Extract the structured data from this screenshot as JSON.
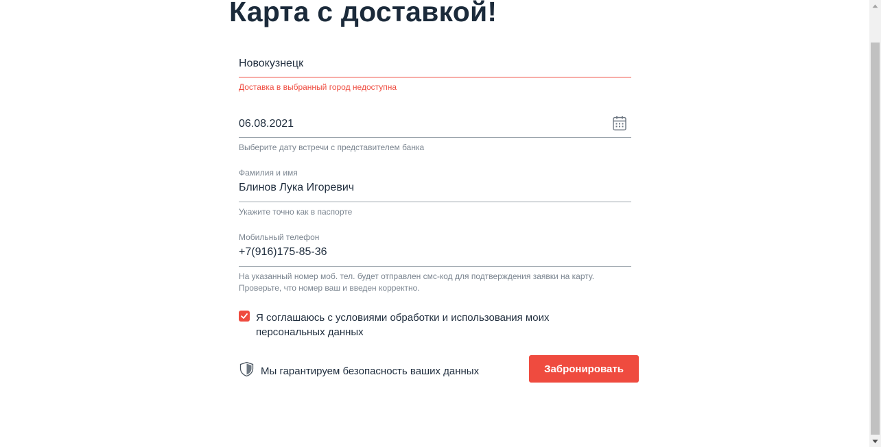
{
  "page": {
    "title": "Карта с доставкой!"
  },
  "city": {
    "value": "Новокузнецк",
    "error": "Доставка в выбранный город недоступна"
  },
  "date": {
    "value": "06.08.2021",
    "hint": "Выберите дату встречи с представителем банка",
    "icon": "calendar-icon"
  },
  "name": {
    "label": "Фамилия и имя",
    "value": "Блинов Лука Игоревич",
    "hint": "Укажите точно как в паспорте"
  },
  "phone": {
    "label": "Мобильный телефон",
    "value": "+7(916)175-85-36",
    "hint_line1": "На указанный номер моб. тел. будет отправлен смс-код для подтверждения заявки на карту.",
    "hint_line2": "Проверьте, что номер ваш и введен корректно."
  },
  "agreement": {
    "checked": true,
    "text": "Я соглашаюсь с условиями обработки и использования моих персональных данных"
  },
  "security": {
    "text": "Мы гарантируем безопасность ваших данных",
    "icon": "shield-icon"
  },
  "submit": {
    "label": "Забронировать"
  },
  "colors": {
    "accent": "#ef4b3f",
    "text": "#1f2d3d",
    "hint": "#7b8590"
  }
}
